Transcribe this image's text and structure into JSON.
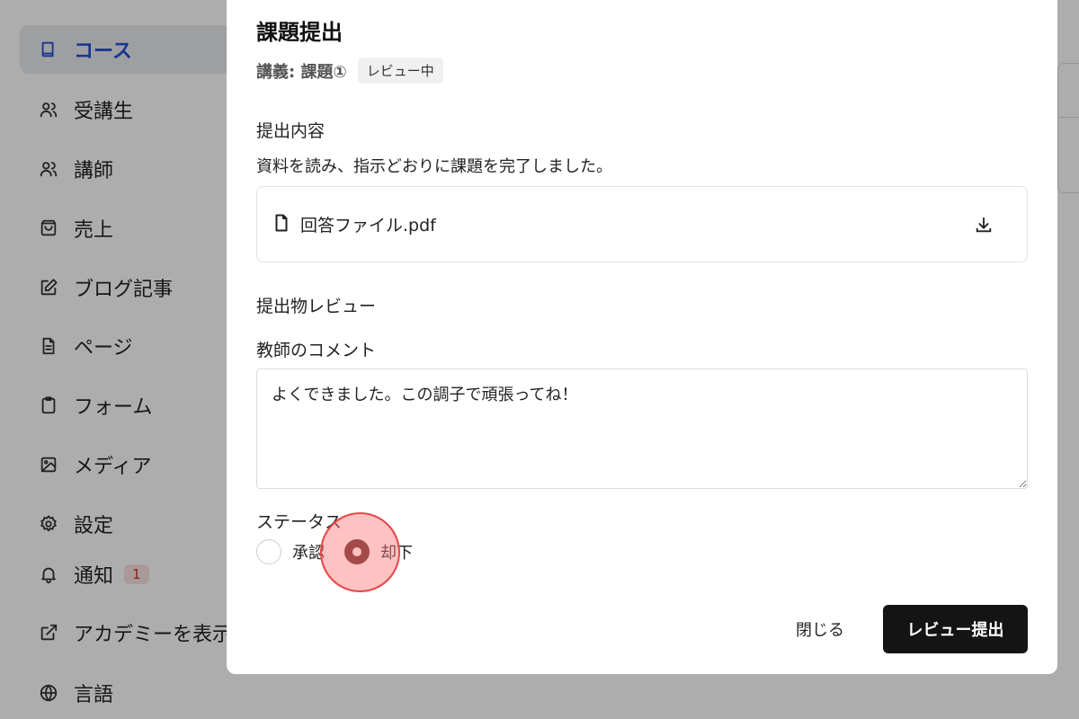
{
  "sidebar": {
    "items": [
      {
        "label": "コース",
        "icon": "book-icon",
        "active": true
      },
      {
        "label": "受講生",
        "icon": "users-icon"
      },
      {
        "label": "講師",
        "icon": "users-icon"
      },
      {
        "label": "売上",
        "icon": "shopping-bag-icon"
      },
      {
        "label": "ブログ記事",
        "icon": "edit-icon"
      },
      {
        "label": "ページ",
        "icon": "file-text-icon"
      },
      {
        "label": "フォーム",
        "icon": "clipboard-icon"
      },
      {
        "label": "メディア",
        "icon": "image-icon"
      },
      {
        "label": "設定",
        "icon": "gear-icon"
      },
      {
        "label": "通知",
        "icon": "bell-icon",
        "badge": "1"
      },
      {
        "label": "アカデミーを表示",
        "icon": "external-link-icon"
      },
      {
        "label": "言語",
        "icon": "globe-icon"
      }
    ]
  },
  "modal": {
    "title": "課題提出",
    "meta": "講義: 課題①",
    "status_chip": "レビュー中",
    "submission_label": "提出内容",
    "submission_text": "資料を読み、指示どおりに課題を完了しました。",
    "file_name": "回答ファイル.pdf",
    "review_label": "提出物レビュー",
    "comment_label": "教師のコメント",
    "comment_value": "よくできました。この調子で頑張ってね！",
    "status_label": "ステータス",
    "options": [
      {
        "label": "承認",
        "checked": false
      },
      {
        "label": "却下",
        "checked": true
      }
    ],
    "close_label": "閉じる",
    "submit_label": "レビュー提出"
  },
  "colors": {
    "accent": "#1f4fd1",
    "primary_button": "#141414",
    "radio_checked": "#5a2525",
    "badge_bg": "#fbe2e2",
    "badge_text": "#c0392b",
    "click_indicator": "#e84545"
  }
}
